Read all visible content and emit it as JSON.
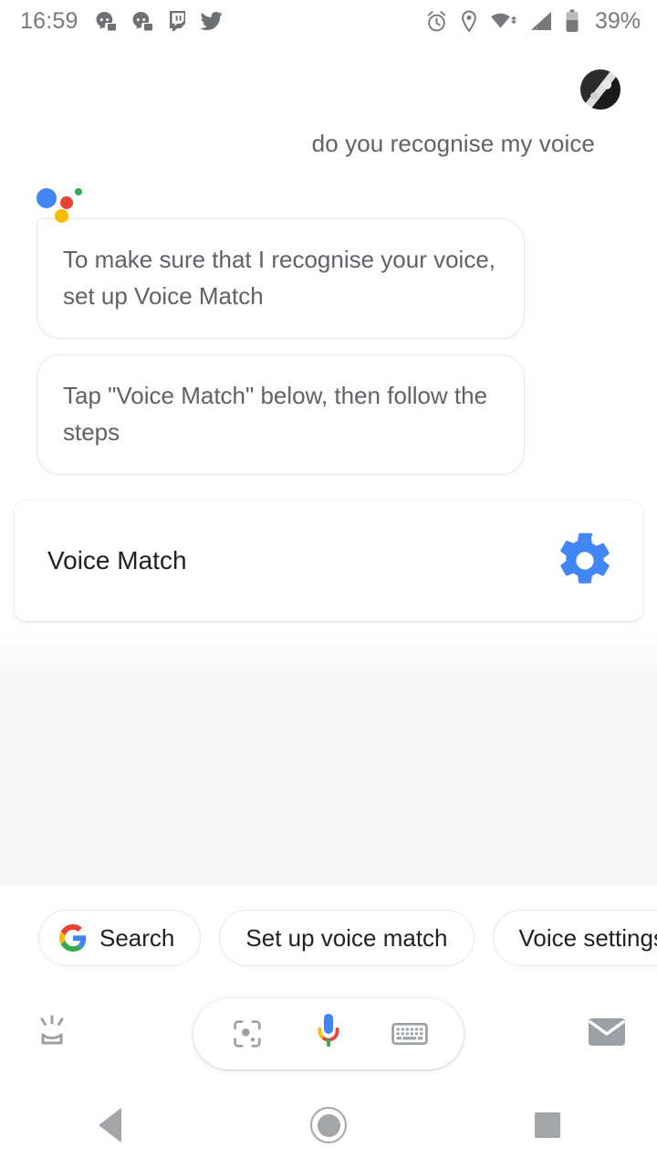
{
  "status_bar": {
    "clock": "16:59",
    "battery_percent": "39%",
    "left_icons": [
      "discord-icon",
      "discord-icon",
      "twitch-icon",
      "twitter-icon"
    ],
    "right_icons": [
      "alarm-icon",
      "location-icon",
      "wifi-icon",
      "cellular-signal-icon",
      "battery-icon"
    ]
  },
  "conversation": {
    "avatar": "user-avatar",
    "user_query": "do you recognise my voice",
    "assistant_logo": "google-assistant-logo",
    "responses": [
      "To make sure that I recognise your voice, set up Voice Match",
      "Tap \"Voice Match\" below, then follow the steps"
    ],
    "card": {
      "title": "Voice Match",
      "icon": "gear-icon",
      "icon_color": "#4285f4"
    }
  },
  "suggestions": [
    {
      "label": "Search",
      "icon": "google-g-icon"
    },
    {
      "label": "Set up voice match",
      "icon": ""
    },
    {
      "label": "Voice settings",
      "icon": ""
    }
  ],
  "bottom_bar": {
    "snapshot_icon": "snapshot-icon",
    "lens_icon": "lens-icon",
    "mic_icon": "google-mic-icon",
    "keyboard_icon": "keyboard-icon",
    "mail_icon": "mail-icon"
  },
  "nav_bar": {
    "back": "back-button",
    "home": "home-button",
    "recents": "recents-button"
  },
  "colors": {
    "google_blue": "#4285f4",
    "google_red": "#ea4335",
    "google_yellow": "#fbbc05",
    "google_green": "#34a853",
    "text_primary": "#202124",
    "text_secondary": "#5f6368"
  }
}
